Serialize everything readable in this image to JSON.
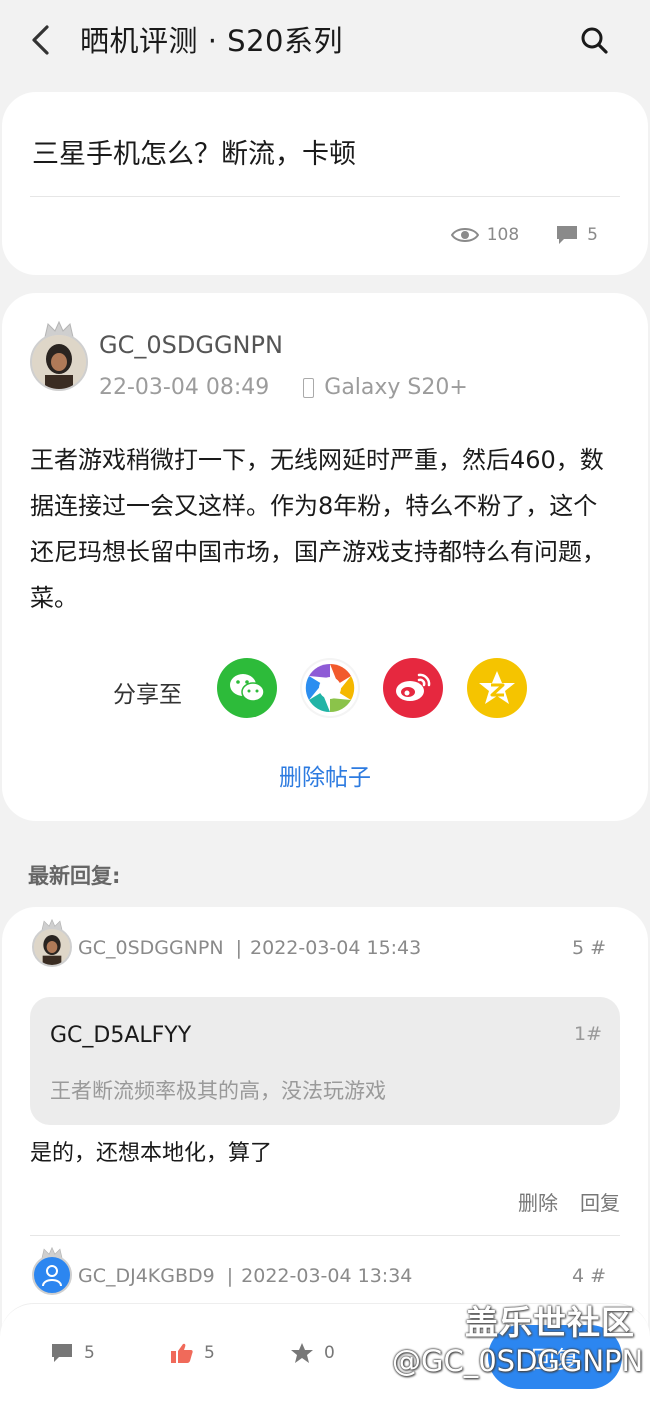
{
  "header": {
    "title": "晒机评测 · S20系列",
    "back_icon": "chevron-left-icon",
    "search_icon": "search-icon"
  },
  "title_card": {
    "post_title": "三星手机怎么？断流，卡顿",
    "views": "108",
    "comments": "5"
  },
  "post": {
    "author": "GC_0SDGGNPN",
    "datetime": "22-03-04 08:49",
    "device": "Galaxy S20+",
    "body": "王者游戏稍微打一下，无线网延时严重，然后460，数据连接过一会又这样。作为8年粉，特么不粉了，这个还尼玛想长留中国市场，国产游戏支持都特么有问题，菜。",
    "share_label": "分享至",
    "share_targets": [
      "wechat",
      "moments",
      "weibo",
      "qzone"
    ],
    "delete_label": "删除帖子"
  },
  "replies_section": {
    "label": "最新回复:",
    "replies": [
      {
        "author": "GC_0SDGGNPN",
        "datetime": "2022-03-04 15:43",
        "floor": "5 #",
        "quote_author": "GC_D5ALFYY",
        "quote_floor": "1#",
        "quote_text": "王者断流频率极其的高，没法玩游戏",
        "text": "是的，还想本地化，算了",
        "delete_label": "删除",
        "reply_label": "回复"
      },
      {
        "author": "GC_DJ4KGBD9",
        "datetime": "2022-03-04 13:34",
        "floor": "4 #"
      }
    ]
  },
  "bottom_bar": {
    "comments": "5",
    "likes": "5",
    "favorites": "0",
    "reply_label": "回复"
  },
  "watermark": {
    "site": "盖乐世社区",
    "user": "@GC_0SDGGNPN"
  },
  "colors": {
    "accent_blue": "#2c86f0",
    "link_blue": "#2d7be0",
    "like_red": "#f06a5a",
    "wechat_green": "#2dbb3a",
    "weibo_red": "#e6283f",
    "qzone_yellow": "#f5c400"
  }
}
